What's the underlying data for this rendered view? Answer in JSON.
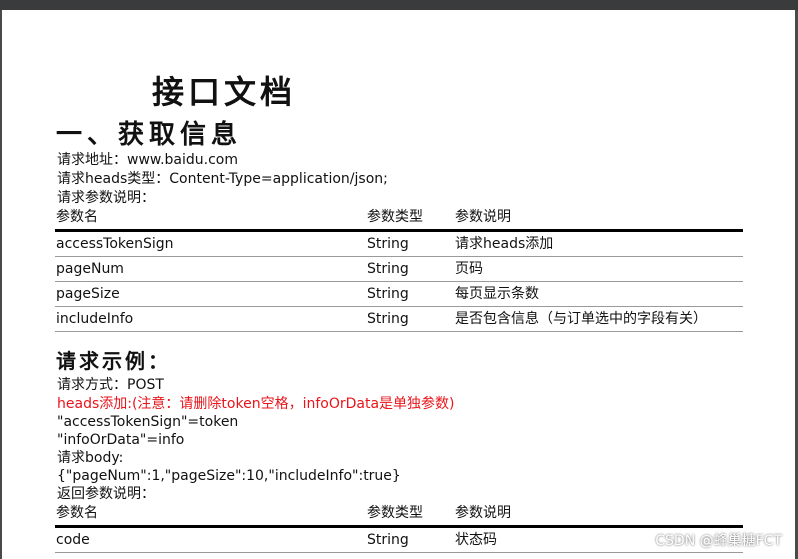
{
  "document": {
    "title": "接口文档",
    "section1_title": "一、获取信息",
    "request_url_line": "请求地址：www.baidu.com",
    "heads_type_line": "请求heads类型：Content-Type=application/json;",
    "request_params_heading": "请求参数说明：",
    "params_table": {
      "headers": [
        "参数名",
        "参数类型",
        "参数说明"
      ],
      "rows": [
        [
          "accessTokenSign",
          "String",
          "请求heads添加"
        ],
        [
          "pageNum",
          "String",
          "页码"
        ],
        [
          "pageSize",
          "String",
          "每页显示条数"
        ],
        [
          "includeInfo",
          "String",
          "是否包含信息（与订单选中的字段有关）"
        ]
      ]
    },
    "example_title": "请求示例：",
    "request_method_line": "请求方式：POST",
    "heads_note_line": "heads添加:(注意：请删除token空格，infoOrData是单独参数)",
    "token_line": "\"accessTokenSign\"=token",
    "info_line": "\"infoOrData\"=info",
    "body_label_line": "请求body:",
    "body_json_line": "{\"pageNum\":1,\"pageSize\":10,\"includeInfo\":true}",
    "return_params_heading": "返回参数说明：",
    "return_table": {
      "headers": [
        "参数名",
        "参数类型",
        "参数说明"
      ],
      "rows": [
        [
          "code",
          "String",
          "状态码"
        ]
      ]
    }
  },
  "watermark": "CSDN @蜂巢糖FCT",
  "colors": {
    "top_bar": "#3a3b3d",
    "note_red": "#e8151b",
    "text": "#111111"
  }
}
